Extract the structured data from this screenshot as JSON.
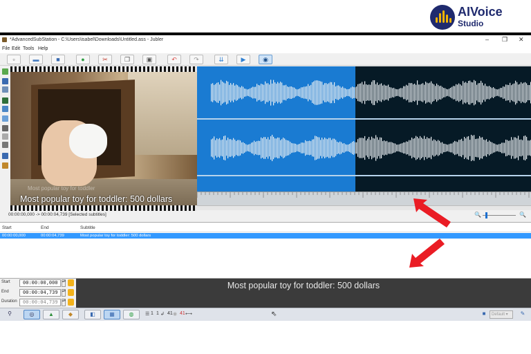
{
  "brand": {
    "name": "AIVoice",
    "sub": "Studio",
    "accent": "#1f2a6e",
    "bar_color": "#f4b400"
  },
  "window": {
    "title": "*AdvancedSubStation - C:\\Users\\isabel\\Downloads\\Untitled.ass - Jubler",
    "controls": {
      "minimize": "–",
      "maximize": "❐",
      "close": "✕"
    }
  },
  "menu": [
    "File",
    "Edit",
    "Tools",
    "Help"
  ],
  "video": {
    "caption": "Most popular toy for toddler: 500 dollars",
    "watermark": "Most popular toy for toddler"
  },
  "waveform": {
    "selection_color": "#1a7bd2",
    "background_color": "#061a26"
  },
  "selection_info": "00:00:00,000 -> 00:00:04,739 [Selected subtitles]",
  "table": {
    "columns": [
      "Start",
      "End",
      "Subtitle"
    ],
    "rows": [
      {
        "start": "00:00:00,000",
        "end": "00:00:04,739",
        "subtitle": "Most popular toy for toddler: 500 dollars",
        "selected": true
      }
    ]
  },
  "editor": {
    "start_label": "Start",
    "start_value": "00:00:00,000",
    "end_label": "End",
    "end_value": "00:00:04,739",
    "duration_label": "Duration",
    "duration_value": "00:00:04,739",
    "text": "Most popular toy for toddler: 500 dollars"
  },
  "bottom_toolbar": {
    "style_label": "Default",
    "indicators": [
      "1",
      "1",
      "41",
      "41"
    ]
  },
  "icons": {
    "undo": "undo-icon",
    "redo": "redo-icon",
    "play": "play-icon",
    "preview": "eye-icon",
    "zoom": "zoom-icon"
  }
}
